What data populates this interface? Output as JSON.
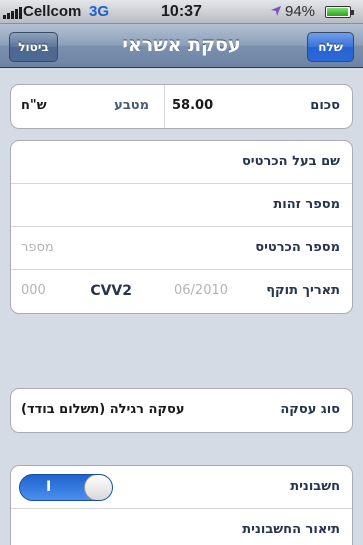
{
  "status_bar": {
    "carrier": "Cellcom",
    "network": "3G",
    "time": "10:37",
    "battery_percent": "94%",
    "battery_level": 0.94,
    "location_icon": "location-arrow-icon"
  },
  "nav": {
    "cancel_label": "ביטול",
    "title": "עסקת אשראי",
    "send_label": "שלח"
  },
  "amount_group": {
    "amount_label": "סכום",
    "amount_value": "58.00",
    "currency_label": "מטבע",
    "currency_value": "ש\"ח"
  },
  "card_group": {
    "holder_label": "שם בעל הכרטיס",
    "id_label": "מספר זהות",
    "card_number_label": "מספר הכרטיס",
    "card_number_placeholder": "מספר",
    "expiry_label": "תאריך תוקף",
    "expiry_placeholder": "06/2010",
    "cvv_label": "CVV2",
    "cvv_placeholder": "000"
  },
  "deal_group": {
    "type_label": "סוג עסקה",
    "type_value": "עסקה רגילה (תשלום בודד)"
  },
  "invoice_group": {
    "invoice_label": "חשבונית",
    "toggle_on_label": "I",
    "toggle_state": true,
    "description_label": "תיאור החשבונית"
  },
  "colors": {
    "nav_bar": "#7b90ad",
    "send_button": "#2663d1",
    "label_text": "#26354e",
    "toggle_on": "#2f78e4",
    "background": "#d5dbe4"
  }
}
